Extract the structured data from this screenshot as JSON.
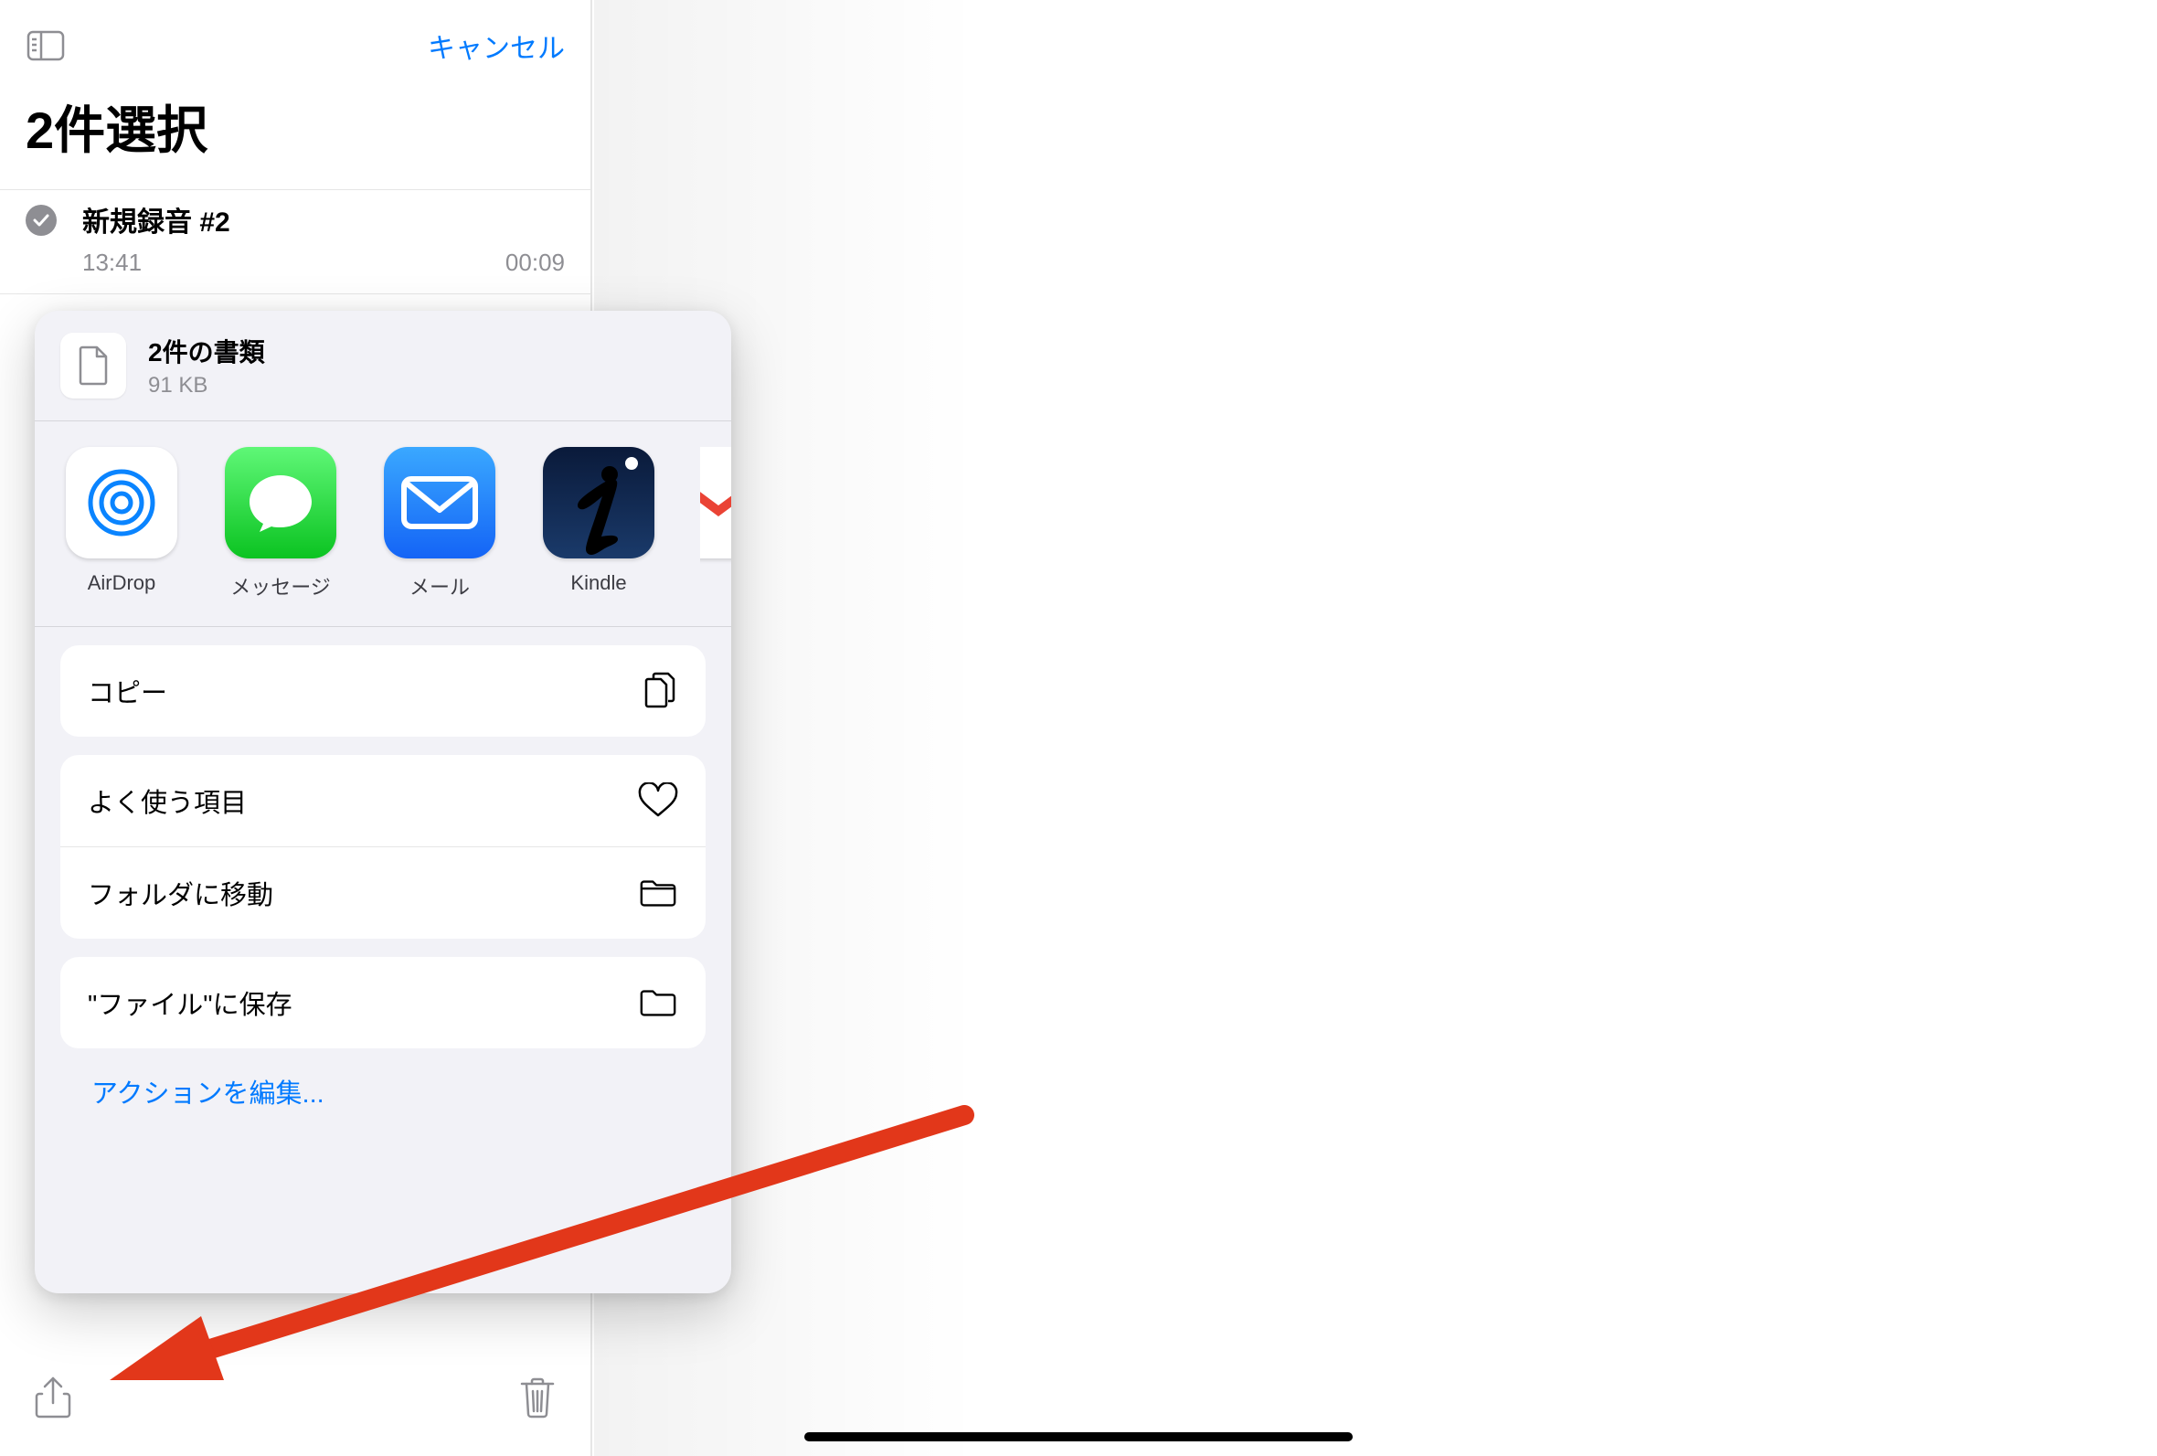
{
  "header": {
    "cancel_label": "キャンセル",
    "selection_title": "2件選択"
  },
  "recording": {
    "title": "新規録音 #2",
    "time": "13:41",
    "duration": "00:09"
  },
  "share": {
    "doc_title": "2件の書類",
    "doc_size": "91 KB",
    "targets": [
      {
        "name": "airdrop",
        "label": "AirDrop"
      },
      {
        "name": "messages",
        "label": "メッセージ"
      },
      {
        "name": "mail",
        "label": "メール"
      },
      {
        "name": "kindle",
        "label": "Kindle"
      },
      {
        "name": "gmail",
        "label": ""
      }
    ],
    "actions_group1": [
      {
        "name": "copy",
        "label": "コピー",
        "icon": "copy-icon"
      }
    ],
    "actions_group2": [
      {
        "name": "favorite",
        "label": "よく使う項目",
        "icon": "heart-icon"
      },
      {
        "name": "move-folder",
        "label": "フォルダに移動",
        "icon": "folder-icon"
      }
    ],
    "actions_group3": [
      {
        "name": "save-files",
        "label": "\"ファイル\"に保存",
        "icon": "folder-open-icon"
      }
    ],
    "edit_actions_label": "アクションを編集..."
  }
}
